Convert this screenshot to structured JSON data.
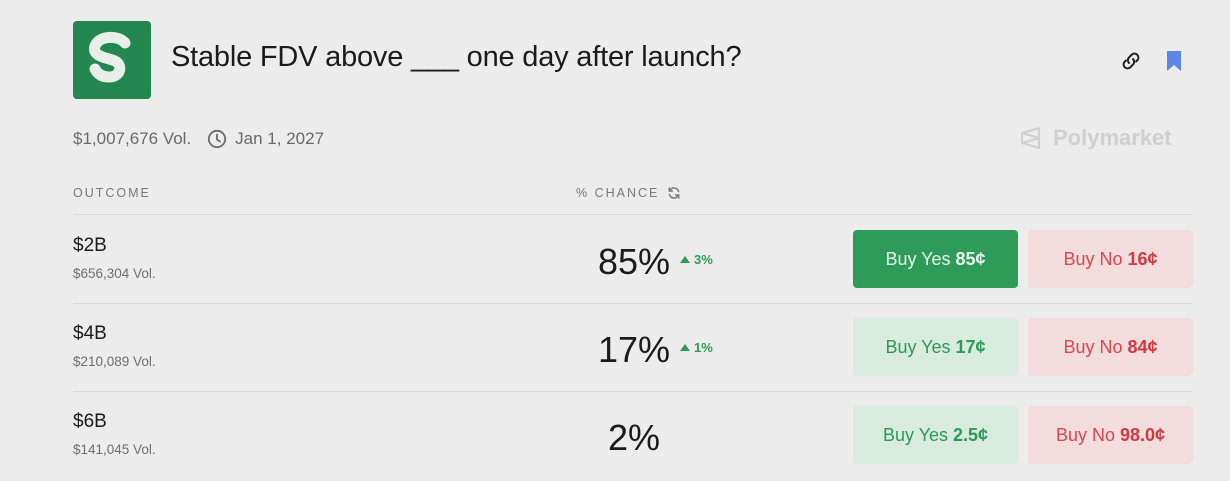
{
  "header": {
    "title": "Stable FDV above ___ one day after launch?",
    "logo_icon": "stable-logo-icon",
    "link_icon": "link-icon",
    "bookmark_icon": "bookmark-icon",
    "brand_color": "#23874f",
    "bookmark_color": "#5b86e5"
  },
  "meta": {
    "volume": "$1,007,676 Vol.",
    "end_date": "Jan 1, 2027",
    "brand": "Polymarket"
  },
  "columns": {
    "outcome": "OUTCOME",
    "chance": "% CHANCE"
  },
  "outcomes": [
    {
      "name": "$2B",
      "volume": "$656,304 Vol.",
      "chance": "85%",
      "delta": "3%",
      "yes_label": "Buy Yes",
      "yes_price": "85¢",
      "no_label": "Buy No",
      "no_price": "16¢"
    },
    {
      "name": "$4B",
      "volume": "$210,089 Vol.",
      "chance": "17%",
      "delta": "1%",
      "yes_label": "Buy Yes",
      "yes_price": "17¢",
      "no_label": "Buy No",
      "no_price": "84¢"
    },
    {
      "name": "$6B",
      "volume": "$141,045 Vol.",
      "chance": "2%",
      "delta": "",
      "yes_label": "Buy Yes",
      "yes_price": "2.5¢",
      "no_label": "Buy No",
      "no_price": "98.0¢"
    }
  ],
  "colors": {
    "yes_active": "#2f9b59",
    "yes_soft": "#d9ebde",
    "no_soft": "#f2dcdd",
    "delta_up": "#2e9a5c"
  }
}
